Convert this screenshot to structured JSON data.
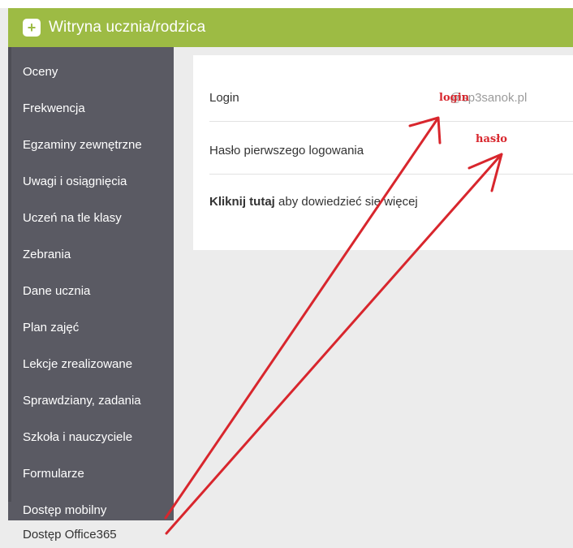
{
  "header": {
    "title": "Witryna ucznia/rodzica",
    "logo_glyph": "+"
  },
  "sidebar": {
    "items": [
      "Oceny",
      "Frekwencja",
      "Egzaminy zewnętrzne",
      "Uwagi i osiągnięcia",
      "Uczeń na tle klasy",
      "Zebrania",
      "Dane ucznia",
      "Plan zajęć",
      "Lekcje zrealizowane",
      "Sprawdziany, zadania",
      "Szkoła i nauczyciele",
      "Formularze",
      "Dostęp mobilny",
      "Dostęp Office365"
    ],
    "active_item": "Dostęp Office365"
  },
  "main": {
    "login_label": "Login",
    "login_placeholder": "login",
    "login_domain": "@sp3sanok.pl",
    "password_label": "Hasło pierwszego logowania",
    "password_placeholder": "hasło",
    "more_link": "Kliknij tutaj",
    "more_text": " aby dowiedzieć się więcej"
  },
  "colors": {
    "header_bg": "#9dbb44",
    "sidebar_bg": "#5a5a63",
    "annotation_red": "#d8262d"
  }
}
